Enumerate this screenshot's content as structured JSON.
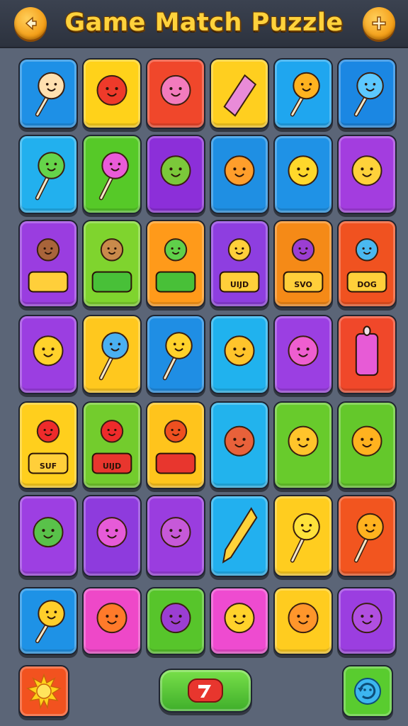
{
  "header": {
    "title": "Game Match Puzzle",
    "back_icon": "back-arrow-icon",
    "add_icon": "plus-icon"
  },
  "board": {
    "rows": [
      [
        {
          "bg": "#1e90e6",
          "icon": "lollipop-face-icon"
        },
        {
          "bg": "#ffd21a",
          "icon": "red-drop-face-icon"
        },
        {
          "bg": "#f0472b",
          "icon": "pink-cotton-candy-icon"
        },
        {
          "bg": "#ffcf1f",
          "icon": "wrapped-candy-icon"
        },
        {
          "bg": "#1fa6ef",
          "icon": "orange-lollipop-icon"
        },
        {
          "bg": "#1b87e3",
          "icon": "blue-lollipop-face-icon"
        }
      ],
      [
        {
          "bg": "#22b0ee",
          "icon": "green-lollipop-face-icon"
        },
        {
          "bg": "#56c928",
          "icon": "pink-bear-lollipop-icon"
        },
        {
          "bg": "#8c2fd9",
          "icon": "green-candy-cane-icon"
        },
        {
          "bg": "#1f8fe3",
          "icon": "orange-sun-face-icon"
        },
        {
          "bg": "#1f92e6",
          "icon": "yellow-sun-face-icon"
        },
        {
          "bg": "#a33ddf",
          "icon": "yellow-ice-cream-icon"
        }
      ],
      [
        {
          "bg": "#9a3de0",
          "icon": "brown-bear-chest-icon",
          "label": ""
        },
        {
          "bg": "#7fd42e",
          "icon": "bear-green-chest-icon",
          "label": ""
        },
        {
          "bg": "#ff9a1a",
          "icon": "green-bear-box-icon",
          "label": ""
        },
        {
          "bg": "#8e3ee0",
          "icon": "lollipop-box-icon",
          "label": "UIJD"
        },
        {
          "bg": "#f58a17",
          "icon": "purple-bear-box-icon",
          "label": "SVO"
        },
        {
          "bg": "#f05220",
          "icon": "blue-blob-box-icon",
          "label": "DOG"
        }
      ],
      [
        {
          "bg": "#9b3ee1",
          "icon": "yellow-balloon-face-icon"
        },
        {
          "bg": "#ffc81e",
          "icon": "blue-popsicle-icon"
        },
        {
          "bg": "#1f8ee4",
          "icon": "yellow-bear-lollipop-icon"
        },
        {
          "bg": "#20b2ee",
          "icon": "bear-candy-rope-icon"
        },
        {
          "bg": "#9b3fe2",
          "icon": "pink-drop-box-icon"
        },
        {
          "bg": "#f0482a",
          "icon": "pink-glass-icon"
        }
      ],
      [
        {
          "bg": "#ffcf1d",
          "icon": "heart-box-icon",
          "label": "SUF"
        },
        {
          "bg": "#73cc2d",
          "icon": "heart-box-red-icon",
          "label": "UIJD"
        },
        {
          "bg": "#ffc41c",
          "icon": "red-bear-box-icon",
          "label": ""
        },
        {
          "bg": "#22b3ed",
          "icon": "bear-purple-gem-icon"
        },
        {
          "bg": "#68cb2c",
          "icon": "bear-cherries-icon"
        },
        {
          "bg": "#64c82b",
          "icon": "flower-face-box-icon"
        }
      ],
      [
        {
          "bg": "#9d3fe2",
          "icon": "green-cabbage-icon"
        },
        {
          "bg": "#8e3bdd",
          "icon": "pink-flower-pretzel-icon"
        },
        {
          "bg": "#9a3ddf",
          "icon": "purple-bear-banana-icon"
        },
        {
          "bg": "#22b0ef",
          "icon": "yellow-crayon-icon"
        },
        {
          "bg": "#ffcd1f",
          "icon": "yellow-face-lollipop-icon"
        },
        {
          "bg": "#f2551f",
          "icon": "orange-lollipop-icon"
        }
      ],
      [
        {
          "bg": "#1e92e6",
          "icon": "yellow-magnifier-face-icon"
        },
        {
          "bg": "#ee48c8",
          "icon": "orange-fruit-face-icon"
        },
        {
          "bg": "#57c52b",
          "icon": "purple-pepper-icon"
        },
        {
          "bg": "#ee4bd0",
          "icon": "yellow-balloon-face-icon"
        },
        {
          "bg": "#ffcc1f",
          "icon": "orange-bear-face-icon"
        },
        {
          "bg": "#9b3ee0",
          "icon": "purple-balloon-face-icon"
        }
      ]
    ]
  },
  "footer": {
    "hint_icon": "sun-icon",
    "play_icon": "arrow-icon",
    "shuffle_icon": "refresh-face-icon"
  }
}
